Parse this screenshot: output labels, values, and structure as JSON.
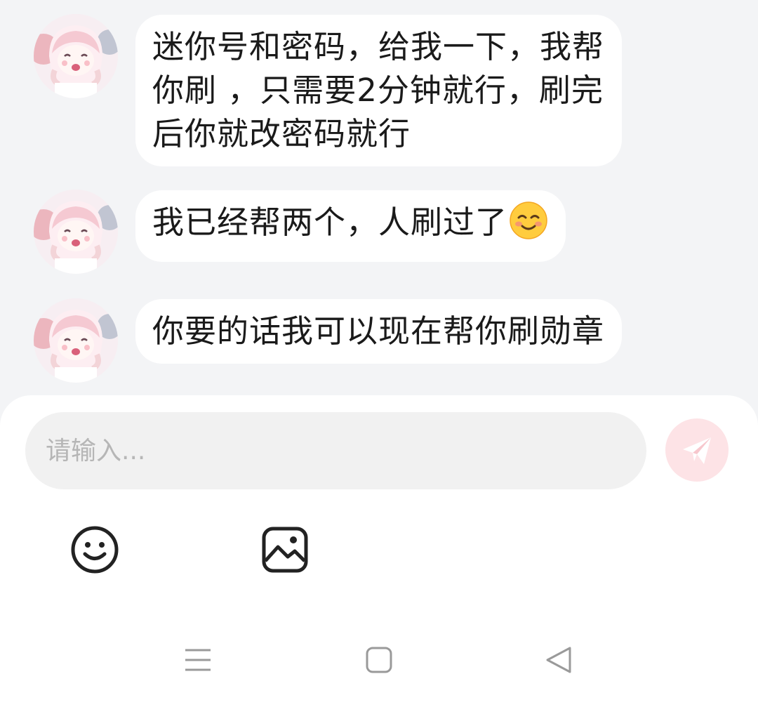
{
  "messages": [
    {
      "lines": [
        "迷你号和密码，给我一下，我帮",
        "你刷 ，只需要2分钟就行，刷完",
        "后你就改密码就行"
      ]
    },
    {
      "text": "我已经帮两个，人刷过了",
      "emoji": "smiling-face-with-blush"
    },
    {
      "text": "你要的话我可以现在帮你刷勋章"
    }
  ],
  "composer": {
    "placeholder": "请输入...",
    "send_icon": "paper-plane-icon",
    "tools": [
      "smiley-icon",
      "image-icon"
    ]
  },
  "navbar": {
    "icons": [
      "menu-icon",
      "home-square-icon",
      "back-triangle-icon"
    ]
  },
  "colors": {
    "background": "#f3f4f6",
    "bubble": "#ffffff",
    "send_button": "#fde3e6"
  }
}
